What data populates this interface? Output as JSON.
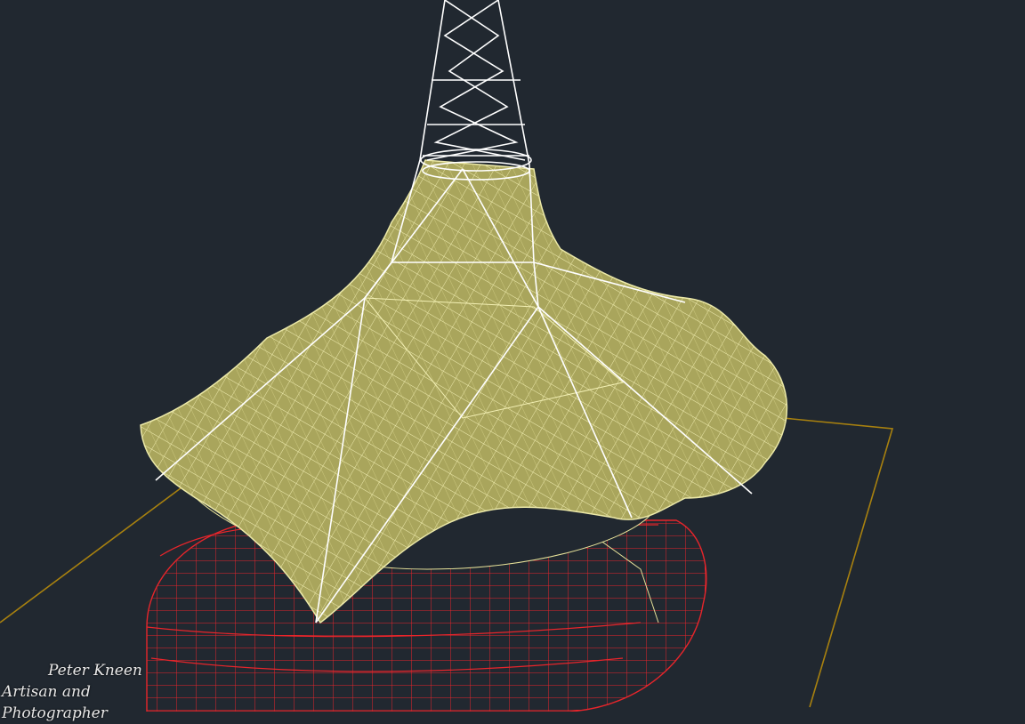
{
  "colors": {
    "background": "#212830",
    "canopy_fill": "#a9a55c",
    "canopy_mesh": "#ece9a8",
    "tower": "#ffffff",
    "base": "#e8252b",
    "ground_line": "#a8810f"
  },
  "watermark": {
    "name": "Peter Kneen",
    "subtitle": "Artisan and Photographer"
  }
}
